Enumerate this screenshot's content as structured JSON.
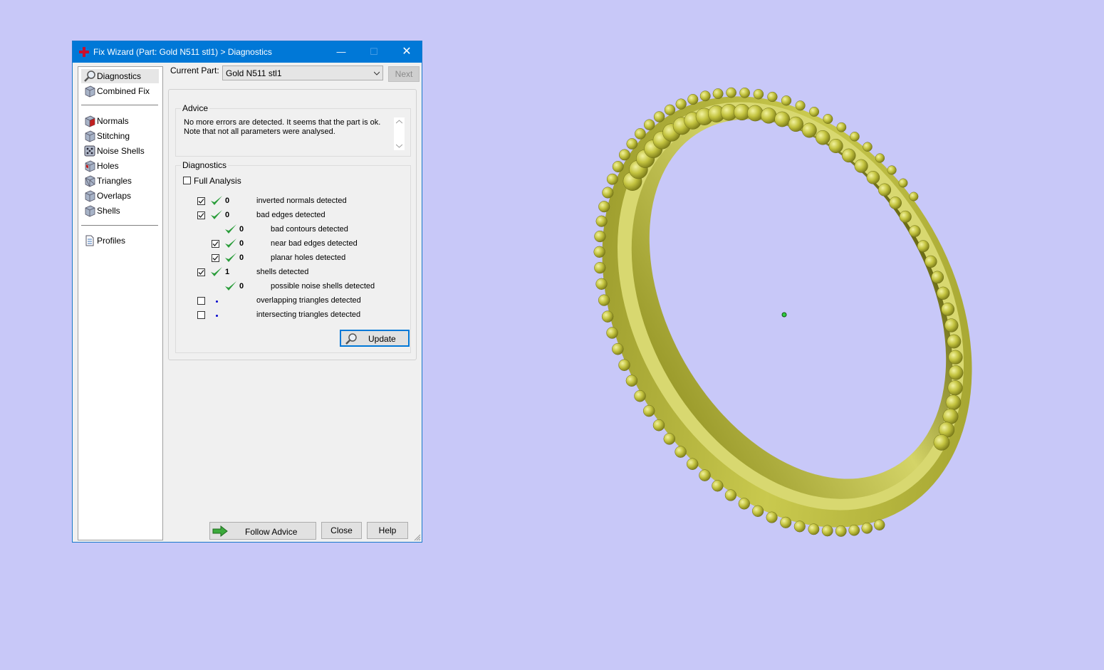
{
  "window": {
    "title": "Fix Wizard (Part: Gold N511 stl1) > Diagnostics",
    "controls": {
      "minimize": "—",
      "maximize": "☐",
      "close": "✕"
    }
  },
  "sidebar": {
    "items": [
      {
        "label": "Diagnostics",
        "icon": "magnifier-icon",
        "selected": true
      },
      {
        "label": "Combined Fix",
        "icon": "cube-icon"
      },
      {
        "label": "Normals",
        "icon": "cube-red-face-icon"
      },
      {
        "label": "Stitching",
        "icon": "cube-icon"
      },
      {
        "label": "Noise Shells",
        "icon": "dice-icon"
      },
      {
        "label": "Holes",
        "icon": "cube-hole-icon"
      },
      {
        "label": "Triangles",
        "icon": "cube-triangle-icon"
      },
      {
        "label": "Overlaps",
        "icon": "cube-icon"
      },
      {
        "label": "Shells",
        "icon": "cube-icon"
      },
      {
        "label": "Profiles",
        "icon": "document-icon"
      }
    ]
  },
  "current_part": {
    "label": "Current Part:",
    "value": "Gold N511 stl1"
  },
  "next_button": "Next",
  "advice": {
    "legend": "Advice",
    "line1": "No more errors are detected. It seems that the part is ok.",
    "line2": "Note that not all parameters were analysed."
  },
  "diagnostics": {
    "legend": "Diagnostics",
    "full_analysis": {
      "label": "Full Analysis",
      "checked": false
    },
    "rows": [
      {
        "label": "inverted normals detected",
        "count": "0",
        "checked": true,
        "status": "ok",
        "indent": 0
      },
      {
        "label": "bad edges detected",
        "count": "0",
        "checked": true,
        "status": "ok",
        "indent": 0
      },
      {
        "label": "bad contours detected",
        "count": "0",
        "checked": null,
        "status": "ok",
        "indent": 1
      },
      {
        "label": "near bad edges detected",
        "count": "0",
        "checked": true,
        "status": "ok",
        "indent": 1
      },
      {
        "label": "planar holes detected",
        "count": "0",
        "checked": true,
        "status": "ok",
        "indent": 1
      },
      {
        "label": "shells detected",
        "count": "1",
        "checked": true,
        "status": "ok",
        "indent": 0
      },
      {
        "label": "possible noise shells detected",
        "count": "0",
        "checked": null,
        "status": "ok",
        "indent": 1
      },
      {
        "label": "overlapping triangles detected",
        "count": "",
        "checked": false,
        "status": "pending",
        "indent": 0
      },
      {
        "label": "intersecting triangles detected",
        "count": "",
        "checked": false,
        "status": "pending",
        "indent": 0
      }
    ],
    "update_button": "Update"
  },
  "footer": {
    "follow_advice": "Follow Advice",
    "close": "Close",
    "help": "Help"
  },
  "colors": {
    "desktop_bg": "#c8c8f8",
    "titlebar": "#0078d7",
    "ring_gold": "#c2c240",
    "check_green": "#2a9d3a"
  }
}
